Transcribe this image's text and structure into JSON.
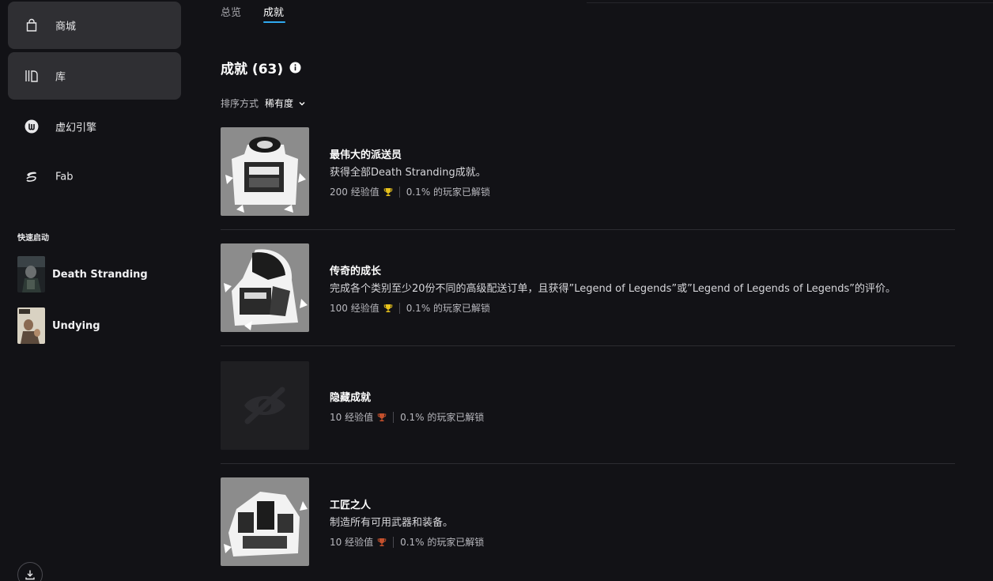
{
  "sidebar": {
    "items": [
      {
        "label": "商城",
        "icon": "shopping-bag-icon"
      },
      {
        "label": "库",
        "icon": "library-icon"
      },
      {
        "label": "虚幻引擎",
        "icon": "unreal-engine-icon"
      },
      {
        "label": "Fab",
        "icon": "fab-icon"
      }
    ],
    "quick_launch_title": "快速启动",
    "quick_launch": [
      {
        "label": "Death Stranding"
      },
      {
        "label": "Undying"
      }
    ]
  },
  "tabs": [
    {
      "label": "总览"
    },
    {
      "label": "成就"
    }
  ],
  "achievements": {
    "title": "成就 (63)",
    "sort_label": "排序方式",
    "sort_value": "稀有度",
    "items": [
      {
        "name": "最伟大的派送员",
        "description": "获得全部Death Stranding成就。",
        "xp": "200 经验值",
        "trophy": "gold",
        "unlock_pct": "0.1% 的玩家已解锁"
      },
      {
        "name": "传奇的成长",
        "description": "完成各个类别至少20份不同的高级配送订单，且获得”Legend of Legends”或”Legend of Legends of Legends”的评价。",
        "xp": "100 经验值",
        "trophy": "gold",
        "unlock_pct": "0.1% 的玩家已解锁"
      },
      {
        "name": "隐藏成就",
        "description": "",
        "xp": "10 经验值",
        "trophy": "bronze",
        "unlock_pct": "0.1% 的玩家已解锁"
      },
      {
        "name": "工匠之人",
        "description": "制造所有可用武器和装备。",
        "xp": "10 经验值",
        "trophy": "bronze",
        "unlock_pct": "0.1% 的玩家已解锁"
      }
    ]
  },
  "colors": {
    "background": "#121216",
    "active_nav": "#2f2f33",
    "tab_accent": "#2fa9f0",
    "trophy_gold": "#e8c21c",
    "trophy_bronze": "#c4502c"
  }
}
